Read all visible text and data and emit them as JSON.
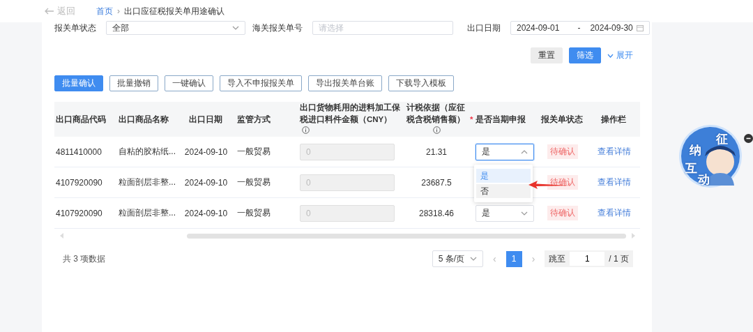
{
  "breadcrumb": {
    "back": "返回",
    "home": "首页",
    "separator": "›",
    "current": "出口应征税报关单用途确认"
  },
  "filters": [
    {
      "kind": "select",
      "label": "报关单状态",
      "value": "全部"
    },
    {
      "kind": "input",
      "label": "海关报关单号",
      "placeholder": "请选择"
    },
    {
      "kind": "daterange",
      "label": "出口日期",
      "start": "2024-09-01",
      "separator": "-",
      "end": "2024-09-30"
    }
  ],
  "filter_actions": [
    {
      "kind": "secondary",
      "label": "重置"
    },
    {
      "kind": "primary",
      "label": "筛选"
    },
    {
      "kind": "link",
      "label": "展开"
    }
  ],
  "actions": [
    {
      "label": "批量确认",
      "primary": true
    },
    {
      "label": "批量撤销",
      "primary": false
    },
    {
      "label": "一键确认",
      "primary": false
    },
    {
      "label": "导入不申报报关单",
      "primary": false
    },
    {
      "label": "导出报关单台账",
      "primary": false
    },
    {
      "label": "下载导入模板",
      "primary": false
    }
  ],
  "table": {
    "columns": [
      {
        "label": "出口商品代码",
        "info": false
      },
      {
        "label": "出口商品名称",
        "info": false
      },
      {
        "label": "出口日期",
        "info": false
      },
      {
        "label": "监管方式",
        "info": false
      },
      {
        "label": "出口货物耗用的进料加工保税进口料件金额（CNY）",
        "info": true
      },
      {
        "label": "计税依据（应征税含税销售额）",
        "info": true
      },
      {
        "label": "是否当期申报",
        "info": false,
        "marker": "*"
      },
      {
        "label": "报关单状态",
        "info": false
      },
      {
        "label": "操作栏",
        "info": false
      }
    ],
    "rows": [
      {
        "code": "4811410000",
        "name": "自粘的胶粘纸...",
        "date": "2024-09-10",
        "method": "一般贸易",
        "amount": "0",
        "basis": "21.31",
        "declare": "是",
        "open": true,
        "status": "待确认",
        "action": "查看详情"
      },
      {
        "code": "4107920090",
        "name": "粒面剖层非整...",
        "date": "2024-09-10",
        "method": "一般贸易",
        "amount": "0",
        "basis": "23687.5",
        "status": "待确认",
        "action": "查看详情"
      },
      {
        "code": "4107920090",
        "name": "粒面剖层非整...",
        "date": "2024-09-10",
        "method": "一般贸易",
        "amount": "0",
        "basis": "28318.46",
        "declare": "是",
        "open": false,
        "status": "待确认",
        "action": "查看详情"
      }
    ]
  },
  "dropdown": {
    "options": [
      {
        "label": "是",
        "selected": true,
        "hovered": false
      },
      {
        "label": "否",
        "selected": false,
        "hovered": true
      }
    ]
  },
  "annotation": {
    "kind": "arrow"
  },
  "pagination": {
    "total": "共 3 项数据",
    "page_size": "5 条/页",
    "prev": "‹",
    "pages": [
      {
        "label": "1",
        "selected": true
      }
    ],
    "next": "›",
    "goto_label": "跳至",
    "goto_value": "1",
    "page_count": "/ 1 页"
  },
  "widget": {
    "chars": [
      "征",
      "纳",
      "互",
      "动"
    ]
  }
}
